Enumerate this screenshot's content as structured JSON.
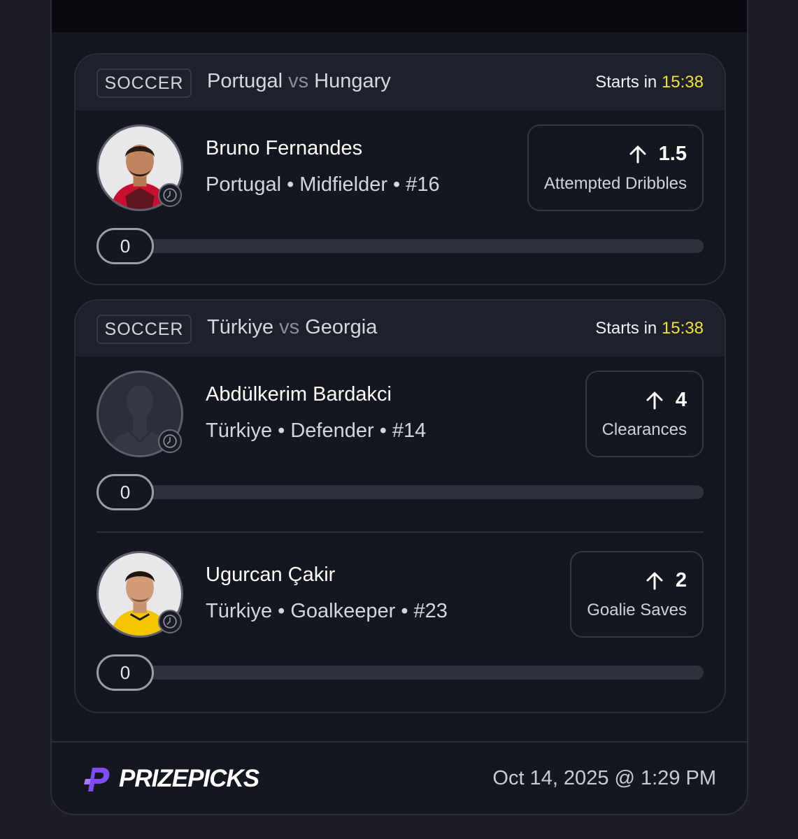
{
  "cards": [
    {
      "sport": "SOCCER",
      "team_home": "Portugal",
      "vs_label": "vs",
      "team_away": "Hungary",
      "starts_label": "Starts in",
      "starts_time": "15:38",
      "picks": [
        {
          "name": "Bruno Fernandes",
          "meta": "Portugal • Midfielder • #16",
          "line": "1.5",
          "direction": "more",
          "stat_type": "Attempted Dribbles",
          "current": "0",
          "progress_fraction": 0,
          "avatar": "player-photo-red-kit"
        }
      ]
    },
    {
      "sport": "SOCCER",
      "team_home": "Türkiye",
      "vs_label": "vs",
      "team_away": "Georgia",
      "starts_label": "Starts in",
      "starts_time": "15:38",
      "picks": [
        {
          "name": "Abdülkerim Bardakci",
          "meta": "Türkiye • Defender • #14",
          "line": "4",
          "direction": "more",
          "stat_type": "Clearances",
          "current": "0",
          "progress_fraction": 0,
          "avatar": "player-silhouette"
        },
        {
          "name": "Ugurcan Çakir",
          "meta": "Türkiye • Goalkeeper • #23",
          "line": "2",
          "direction": "more",
          "stat_type": "Goalie Saves",
          "current": "0",
          "progress_fraction": 0,
          "avatar": "player-photo-yellow-kit"
        }
      ]
    }
  ],
  "footer": {
    "brand": "PRIZEPICKS",
    "timestamp": "Oct 14, 2025 @ 1:29 PM"
  },
  "colors": {
    "accent_time": "#f3e12f",
    "brand_purple": "#7d4cf5",
    "background": "#141620"
  }
}
